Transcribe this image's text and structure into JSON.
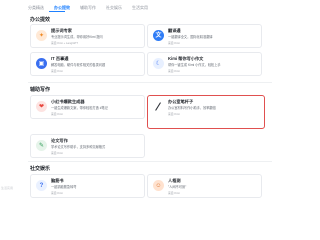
{
  "tabs": [
    {
      "label": "分类精选"
    },
    {
      "label": "办公提效"
    },
    {
      "label": "辅助写作"
    },
    {
      "label": "社交娱乐"
    },
    {
      "label": "生活实用"
    }
  ],
  "sections": {
    "office": "办公提效",
    "writing": "辅助写作",
    "social": "社交娱乐"
  },
  "cards": {
    "c1": {
      "title": "提示词专家",
      "desc": "专业提示词生成，帮你用好Kimi 提问",
      "meta": "来自 Kimi + LangGPT"
    },
    "c2": {
      "title": "翻译通",
      "desc": "一键翻译全文，国际化精准翻译",
      "meta": "来自 Kimi"
    },
    "c3": {
      "title": "IT 百事通",
      "desc": "解答电脑、硬件与软件相关的各类问题",
      "meta": "来自 Kimi"
    },
    "c4": {
      "title": "Kimi 帮你写小作文",
      "desc": "帮你一键生成 Kimi 小作文，轻松上手",
      "meta": "来自 Kimi"
    },
    "c5": {
      "title": "小红书爆款生成器",
      "desc": "一键生成爆款文案，带你轻松打造 #笔记",
      "meta": "来自 Kimi"
    },
    "c6": {
      "title": "办公室笔杆子",
      "desc": "办公室材料写作小助手，效率翻倍",
      "meta": "来自 Kimi"
    },
    "c7": {
      "title": "论文写作",
      "desc": "学术论文写作助手，支持多种文献格式",
      "meta": "来自 Kimi"
    },
    "c8": {
      "title": "脑筋书",
      "desc": "一起猜脑筋急转弯",
      "meta": "来自 Kimi"
    },
    "c9": {
      "title": "人格测",
      "desc": "\"人间不可测\"",
      "meta": "来自 Kimi"
    }
  },
  "colors": {
    "accent": "#1e80ff",
    "highlight_border": "#e0504f"
  },
  "icons": {
    "c1": "prompt-expert-icon",
    "c2": "translate-icon",
    "c3": "it-helper-icon",
    "c4": "moon-icon",
    "c5": "xiaohongshu-icon",
    "c6": "pen-icon",
    "c7": "paper-icon",
    "c8": "brain-teaser-icon",
    "c9": "person-icon"
  },
  "watermark": "生活实用"
}
